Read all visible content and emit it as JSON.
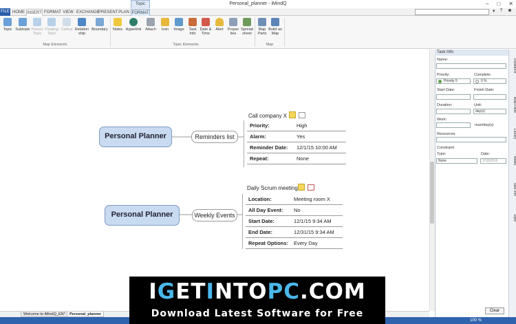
{
  "window": {
    "title": "Personal_planner - iMindQ",
    "context_tab_group": "Topic"
  },
  "tabs": [
    "FILE",
    "HOME",
    "INSERT",
    "FORMAT",
    "VIEW",
    "EXCHANGE",
    "PRESENT",
    "PLAN",
    "FORMAT"
  ],
  "ribbon": {
    "buttons": [
      "Topic",
      "Subtopic",
      "Parent Topic",
      "Floating Topic",
      "Callout",
      "Relation ship",
      "Boundary",
      "Notes",
      "Hyperlink",
      "Attach",
      "Icon",
      "Image",
      "Task Info",
      "Date & Time",
      "Alert",
      "Proper ties",
      "Spread sheet",
      "Map Parts",
      "Build as Map"
    ],
    "groups": [
      "Map Elements",
      "Topic Elements",
      "Map"
    ]
  },
  "map": {
    "topic1": {
      "root": "Personal Planner",
      "sub": "Reminders list",
      "table_title": "Call company X",
      "rows": [
        {
          "k": "Priority:",
          "v": "High"
        },
        {
          "k": "Alarm:",
          "v": "Yes"
        },
        {
          "k": "Reminder Date:",
          "v": "12/1/15 10:00 AM"
        },
        {
          "k": "Repeat:",
          "v": "None"
        }
      ]
    },
    "topic2": {
      "root": "Personal Planner",
      "sub": "Weekly Events",
      "table_title": "Daily Scrum meeting",
      "rows": [
        {
          "k": "Location:",
          "v": "Meeting room X"
        },
        {
          "k": "All Day Event:",
          "v": "No"
        },
        {
          "k": "Start Date:",
          "v": "12/1/15 9:34 AM"
        },
        {
          "k": "End Date:",
          "v": "12/31/15 9:34 AM"
        },
        {
          "k": "Repeat Options:",
          "v": "Every Day"
        }
      ]
    }
  },
  "panel": {
    "title": "Task Info",
    "name_label": "Name:",
    "priority_label": "Priority:",
    "priority_value": "Priority 5",
    "complete_label": "Complete:",
    "complete_value": "0 %",
    "start_label": "Start Date:",
    "finish_label": "Finish Date:",
    "duration_label": "Duration:",
    "unit_label": "Unit:",
    "unit_value": "day(s)",
    "work_label": "Work:",
    "work_unit": "man/day(s)",
    "resources_label": "Resources:",
    "constraint_label": "Constraint",
    "type_label": "Type:",
    "type_value": "None",
    "date_label": "Date:",
    "date_value": "2/18/2016",
    "clear_label": "Clear"
  },
  "dock": [
    "Research",
    "Map Parts",
    "Library",
    "Notes",
    "Task Info",
    "Style"
  ],
  "sheets": [
    "Welcome to iMindQ_EN*",
    "Personal_planner"
  ],
  "status": {
    "zoom": "100 %"
  },
  "watermark": {
    "title_parts": [
      {
        "t": "I",
        "c": "#ffffff"
      },
      {
        "t": "G",
        "c": "#4ab7ea"
      },
      {
        "t": "ET",
        "c": "#ffffff"
      },
      {
        "t": "I",
        "c": "#4ab7ea"
      },
      {
        "t": "NTO",
        "c": "#ffffff"
      },
      {
        "t": "PC",
        "c": "#4ab7ea"
      },
      {
        "t": ".COM",
        "c": "#ffffff"
      }
    ],
    "subtitle": "Download Latest Software for Free"
  },
  "colors": {
    "file_tab": "#2a5faa",
    "status_bar": "#2f63ad",
    "root_fill": "#c9dbf0",
    "accent": "#4ab7ea"
  }
}
